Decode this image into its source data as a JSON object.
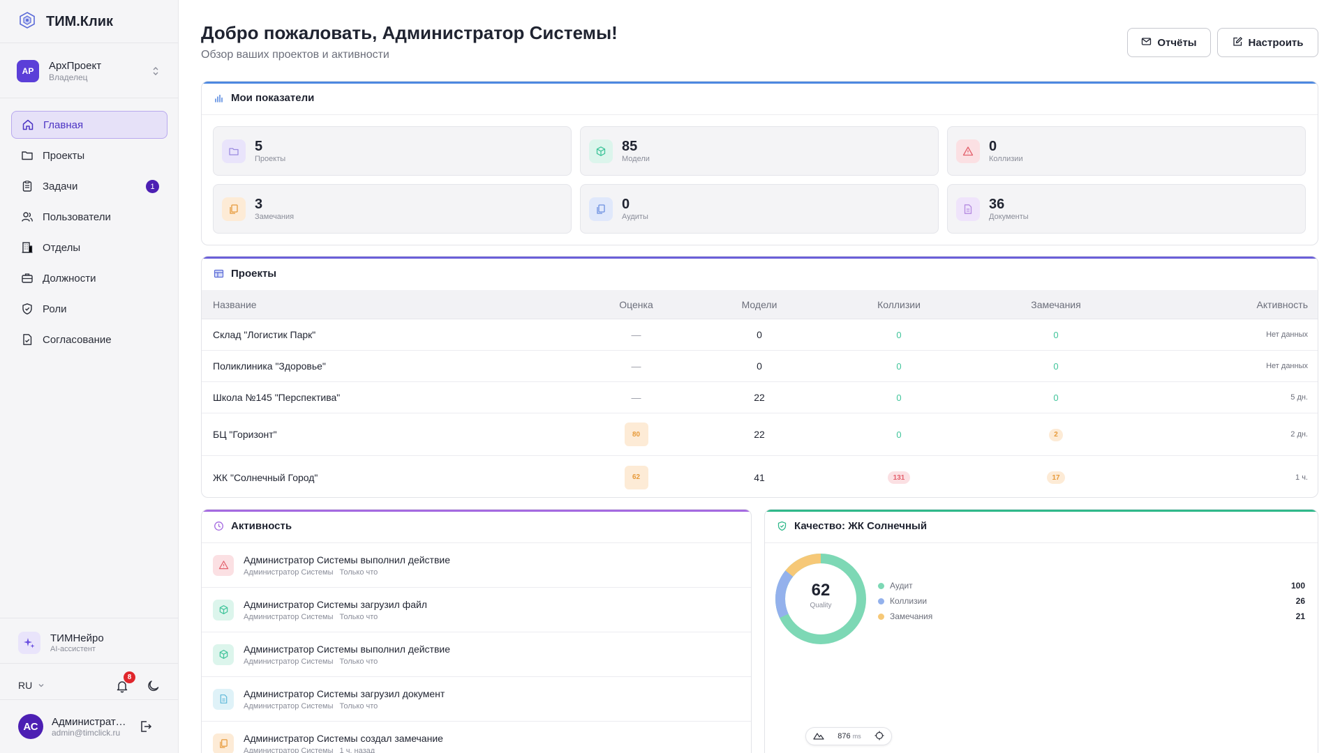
{
  "app": {
    "name": "ТИМ.Клик"
  },
  "org": {
    "initials": "АР",
    "name": "АрхПроект",
    "role": "Владелец"
  },
  "nav": [
    {
      "label": "Главная",
      "icon": "home-icon",
      "active": true
    },
    {
      "label": "Проекты",
      "icon": "folder-icon"
    },
    {
      "label": "Задачи",
      "icon": "clipboard-icon",
      "badge": "1"
    },
    {
      "label": "Пользователи",
      "icon": "users-icon"
    },
    {
      "label": "Отделы",
      "icon": "building-icon"
    },
    {
      "label": "Должности",
      "icon": "briefcase-icon"
    },
    {
      "label": "Роли",
      "icon": "shield-icon"
    },
    {
      "label": "Согласование",
      "icon": "file-check-icon"
    }
  ],
  "assistant": {
    "name": "ТИМНейро",
    "subtitle": "AI-ассистент"
  },
  "footer": {
    "lang": "RU",
    "notifications": "8"
  },
  "user": {
    "initials": "АС",
    "name": "Администратор Системы",
    "email": "admin@timclick.ru"
  },
  "header": {
    "title": "Добро пожаловать, Администратор Системы!",
    "subtitle": "Обзор ваших проектов и активности",
    "reports_label": "Отчёты",
    "settings_label": "Настроить"
  },
  "metrics": {
    "title": "Мои показатели",
    "items": [
      {
        "value": "5",
        "label": "Проекты",
        "icon": "folder-icon",
        "color": "#9b8ae0",
        "bg": "#e9e4fb"
      },
      {
        "value": "85",
        "label": "Модели",
        "icon": "cube-icon",
        "color": "#3fc49a",
        "bg": "#dcf5ec"
      },
      {
        "value": "0",
        "label": "Коллизии",
        "icon": "warning-icon",
        "color": "#e3606c",
        "bg": "#fbe0e3"
      },
      {
        "value": "3",
        "label": "Замечания",
        "icon": "copy-icon",
        "color": "#e79a3a",
        "bg": "#fdebd6"
      },
      {
        "value": "0",
        "label": "Аудиты",
        "icon": "copy-icon",
        "color": "#6b8fe0",
        "bg": "#e0e8fb"
      },
      {
        "value": "36",
        "label": "Документы",
        "icon": "document-icon",
        "color": "#b58ae0",
        "bg": "#efe4fb"
      }
    ]
  },
  "projects": {
    "title": "Проекты",
    "columns": [
      "Название",
      "Оценка",
      "Модели",
      "Коллизии",
      "Замечания",
      "Активность"
    ],
    "rows": [
      {
        "name": "Склад \"Логистик Парк\"",
        "score": "—",
        "models": "0",
        "collisions": "0",
        "remarks": "0",
        "activity": "Нет данных"
      },
      {
        "name": "Поликлиника \"Здоровье\"",
        "score": "—",
        "models": "0",
        "collisions": "0",
        "remarks": "0",
        "activity": "Нет данных"
      },
      {
        "name": "Школа №145 \"Перспектива\"",
        "score": "—",
        "models": "22",
        "collisions": "0",
        "remarks": "0",
        "activity": "5 дн."
      },
      {
        "name": "БЦ \"Горизонт\"",
        "score": "80",
        "models": "22",
        "collisions": "0",
        "remarks": "2",
        "activity": "2 дн."
      },
      {
        "name": "ЖК \"Солнечный Город\"",
        "score": "62",
        "models": "41",
        "collisions": "131",
        "remarks": "17",
        "activity": "1 ч."
      }
    ]
  },
  "activity": {
    "title": "Активность",
    "items": [
      {
        "title": "Администратор Системы выполнил действие",
        "author": "Администратор Системы",
        "time": "Только что",
        "icon": "warning-icon",
        "color": "#e3606c",
        "bg": "#fbe0e3"
      },
      {
        "title": "Администратор Системы загрузил файл",
        "author": "Администратор Системы",
        "time": "Только что",
        "icon": "cube-icon",
        "color": "#3fc49a",
        "bg": "#dcf5ec"
      },
      {
        "title": "Администратор Системы выполнил действие",
        "author": "Администратор Системы",
        "time": "Только что",
        "icon": "cube-icon",
        "color": "#3fc49a",
        "bg": "#dcf5ec"
      },
      {
        "title": "Администратор Системы загрузил документ",
        "author": "Администратор Системы",
        "time": "Только что",
        "icon": "document-icon",
        "color": "#5fb8d8",
        "bg": "#dff2f8"
      },
      {
        "title": "Администратор Системы создал замечание",
        "author": "Администратор Системы",
        "time": "1 ч. назад",
        "icon": "copy-icon",
        "color": "#e79a3a",
        "bg": "#fdebd6"
      }
    ]
  },
  "perf": {
    "value": "876",
    "unit": "ms"
  },
  "quality": {
    "title": "Качество: ЖК Солнечный",
    "score": "62",
    "score_label": "Quality",
    "colors": {
      "audit": "#7dd8b5",
      "collisions": "#93b1ec",
      "remarks": "#f6c877"
    },
    "legend": [
      {
        "label": "Аудит",
        "value": "100"
      },
      {
        "label": "Коллизии",
        "value": "26"
      },
      {
        "label": "Замечания",
        "value": "21"
      }
    ]
  }
}
